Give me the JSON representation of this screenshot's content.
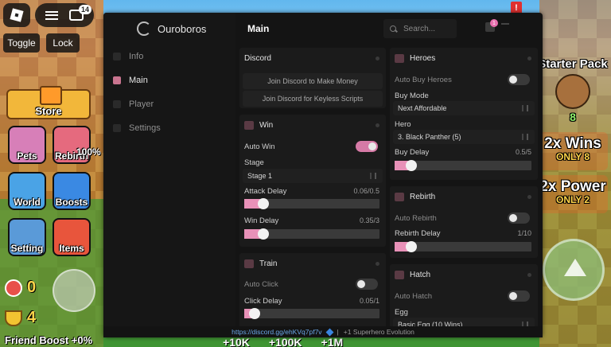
{
  "game": {
    "toggle_label": "Toggle",
    "lock_label": "Lock",
    "notifications": "14",
    "alert": "!",
    "store": "Store",
    "tiles": [
      "Pets",
      "Rebirth",
      "World",
      "Boosts",
      "Setting",
      "Items"
    ],
    "rebirth_percent": "100%",
    "stat_orbs": "0",
    "stat_trophies": "4",
    "friend_boost": "Friend Boost +0%",
    "starter_pack": "Starter Pack",
    "starter_price": "8",
    "wins_promo": "2x Wins",
    "wins_price": "ONLY 8",
    "power_promo": "2x Power",
    "power_price": "ONLY 2",
    "bottom_values": [
      "+10K",
      "+100K",
      "+1M"
    ]
  },
  "hub": {
    "title": "Ouroboros",
    "section": "Main",
    "search_placeholder": "Search...",
    "user_badge": "1",
    "nav": [
      "Info",
      "Main",
      "Player",
      "Settings"
    ],
    "discord": {
      "title": "Discord",
      "buttons": [
        "Join Discord to Make Money",
        "Join Discord for Keyless Scripts"
      ]
    },
    "win": {
      "title": "Win",
      "auto_win": "Auto Win",
      "auto_win_on": true,
      "stage_label": "Stage",
      "stage_value": "Stage 1",
      "attack_delay_label": "Attack Delay",
      "attack_delay_value": "0.06/0.5",
      "attack_delay_fraction": 0.12,
      "win_delay_label": "Win Delay",
      "win_delay_value": "0.35/3",
      "win_delay_fraction": 0.117
    },
    "train": {
      "title": "Train",
      "auto_click": "Auto Click",
      "auto_click_on": false,
      "click_delay_label": "Click Delay",
      "click_delay_value": "0.05/1",
      "click_delay_fraction": 0.05
    },
    "heroes": {
      "title": "Heroes",
      "auto_buy": "Auto Buy Heroes",
      "auto_buy_on": false,
      "buy_mode_label": "Buy Mode",
      "buy_mode_value": "Next Affordable",
      "hero_label": "Hero",
      "hero_value": "3. Black Panther (5)",
      "buy_delay_label": "Buy Delay",
      "buy_delay_value": "0.5/5",
      "buy_delay_fraction": 0.1
    },
    "rebirth": {
      "title": "Rebirth",
      "auto_rebirth": "Auto Rebirth",
      "auto_rebirth_on": false,
      "rebirth_delay_label": "Rebirth Delay",
      "rebirth_delay_value": "1/10",
      "rebirth_delay_fraction": 0.1
    },
    "hatch": {
      "title": "Hatch",
      "auto_hatch": "Auto Hatch",
      "auto_hatch_on": false,
      "egg_label": "Egg",
      "egg_value": "Basic Egg (10 Wins)"
    },
    "status": {
      "link": "https://discord.gg/ehKVq7pf7v",
      "separator": "|",
      "game": "+1 Superhero Evolution"
    }
  },
  "colors": {
    "accent": "#e891b8",
    "panel": "#141414",
    "card": "#1b1b1b"
  }
}
